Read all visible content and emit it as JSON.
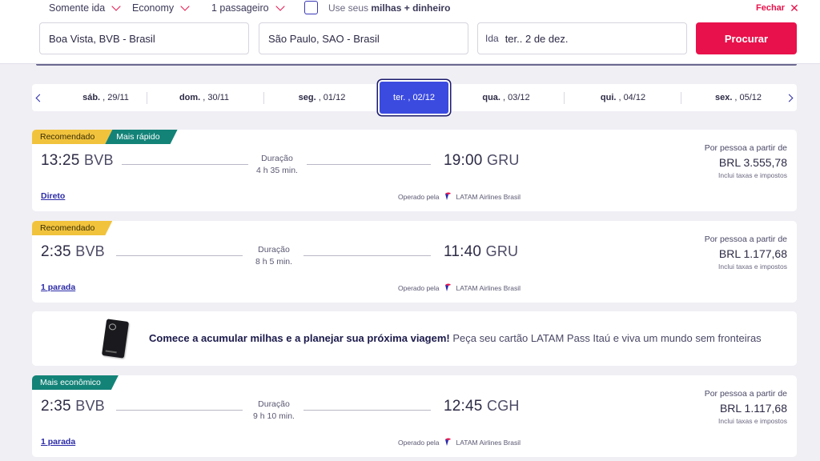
{
  "search": {
    "trip_type": "Somente ida",
    "cabin": "Economy",
    "passengers": "1 passageiro",
    "miles_label_prefix": "Use seus",
    "miles_label_bold": "milhas + dinheiro",
    "close_label": "Fechar",
    "origin": "Boa Vista, BVB - Brasil",
    "destination": "São Paulo, SAO - Brasil",
    "date_label": "Ida",
    "date_value": "ter.. 2 de dez.",
    "search_button": "Procurar"
  },
  "dates": [
    {
      "day": "sáb.",
      "date": ", 29/11"
    },
    {
      "day": "dom.",
      "date": ", 30/11"
    },
    {
      "day": "seg.",
      "date": ", 01/12"
    },
    {
      "day": "ter.",
      "date": ", 02/12"
    },
    {
      "day": "qua.",
      "date": ", 03/12"
    },
    {
      "day": "qui.",
      "date": ", 04/12"
    },
    {
      "day": "sex.",
      "date": ", 05/12"
    }
  ],
  "flights": [
    {
      "tag1": "Recomendado",
      "tag2": "Mais rápido",
      "dep_time": "13:25",
      "dep_code": "BVB",
      "duration_label": "Duração",
      "duration": "4 h 35 min.",
      "arr_time": "19:00",
      "arr_code": "GRU",
      "price_label": "Por pessoa a partir de",
      "price": "BRL 3.555,78",
      "tax_note": "Inclui taxas e impostos",
      "stops": "Direto",
      "operated_by": "Operado pela",
      "airline": "LATAM Airlines Brasil"
    },
    {
      "tag1": "Recomendado",
      "dep_time": "2:35",
      "dep_code": "BVB",
      "duration_label": "Duração",
      "duration": "8 h 5 min.",
      "arr_time": "11:40",
      "arr_code": "GRU",
      "price_label": "Por pessoa a partir de",
      "price": "BRL 1.177,68",
      "tax_note": "Inclui taxas e impostos",
      "stops": "1 parada",
      "operated_by": "Operado pela",
      "airline": "LATAM Airlines Brasil"
    },
    {
      "tag1": "Mais econômico",
      "dep_time": "2:35",
      "dep_code": "BVB",
      "duration_label": "Duração",
      "duration": "9 h 10 min.",
      "arr_time": "12:45",
      "arr_code": "CGH",
      "price_label": "Por pessoa a partir de",
      "price": "BRL 1.117,68",
      "tax_note": "Inclui taxas e impostos",
      "stops": "1 parada",
      "operated_by": "Operado pela",
      "airline": "LATAM Airlines Brasil"
    }
  ],
  "banner": {
    "bold": "Comece a acumular milhas e a planejar sua próxima viagem!",
    "text": " Peça seu cartão LATAM Pass Itaú e viva um mundo sem fronteiras"
  },
  "colors": {
    "accent": "#e8114b",
    "primary": "#2b2aa8",
    "selected_date": "#3b4be0",
    "tag_recommended": "#f1c33d",
    "tag_green": "#138378"
  }
}
